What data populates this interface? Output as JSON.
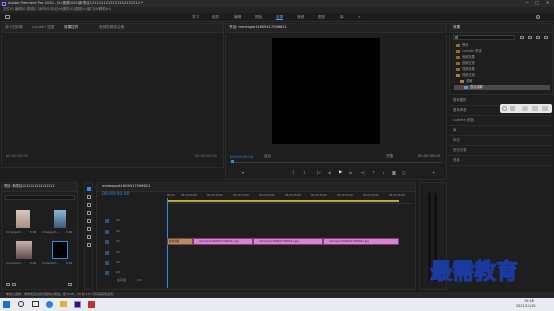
{
  "window": {
    "title": "Adobe Premiere Pro 2020 - D:\\视频\\555\\新项目1212121212121212121212 *",
    "controls": [
      "—",
      "□",
      "✕"
    ]
  },
  "menu": [
    "文件(F)",
    "编辑(E)",
    "剪辑(C)",
    "序列(S)",
    "标记(M)",
    "图形(G)",
    "视图(V)",
    "窗口(W)",
    "帮助(H)"
  ],
  "workspaces": {
    "items": [
      "学习",
      "组件",
      "编辑",
      "颜色",
      "效果",
      "音频",
      "图形",
      "库"
    ],
    "active": 4
  },
  "source_panel": {
    "tabs": [
      "源:(无剪辑)",
      "Lumetri 范围",
      "效果控件",
      "音频剪辑混合器"
    ],
    "active_tab": 2,
    "tc_left": "00:00:00:00",
    "tc_right": "00:00:00:00"
  },
  "program_panel": {
    "tab": "节目: mmexport1609417096621",
    "timecode": "00:00:00:00",
    "fit": "适合",
    "quality": "完整",
    "duration": "00:00:09:03"
  },
  "effects_panel": {
    "tab": "效果",
    "search_placeholder": "",
    "items": [
      "预设",
      "Lumetri 预设",
      "音频效果",
      "音频过渡",
      "视频效果",
      "视频过渡"
    ],
    "subitems": [
      "溶解",
      "叠加溶解"
    ]
  },
  "right_sections": [
    "基本图形",
    "基本声音",
    "Lumetri 颜色",
    "库",
    "标记",
    "历史记录",
    "信息"
  ],
  "project_panel": {
    "tabs": [
      "项目: 新项目1212121212121212",
      "媒体浏览器",
      "库",
      "信息"
    ],
    "thumbs": [
      {
        "name": "mmexport...",
        "dur": "5:00"
      },
      {
        "name": "mmexport...",
        "dur": "5:00"
      },
      {
        "name": "mmexport...",
        "dur": "5:00"
      },
      {
        "name": "mmexport...",
        "dur": "9:03"
      }
    ]
  },
  "timeline": {
    "tab": "mmexport1609417096621",
    "timecode": "00:00:00:00",
    "ruler": [
      "00:00",
      "00:00:05:00",
      "00:00:10:00",
      "00:00:15:00",
      "00:00:20:00",
      "00:00:25:00",
      "00:00:30:00",
      "00:00:35:00",
      "00:00:40:00",
      "00:00:45:00"
    ],
    "tracks": [
      "V3",
      "V2",
      "V1",
      "A1",
      "A2",
      "A3"
    ],
    "master": "主声道",
    "master_val": "0.0",
    "clips": [
      {
        "label": "叠加溶解"
      },
      {
        "label": "mmexport1609417096621.jpg"
      },
      {
        "label": "mmexport1609417096621.jpg"
      },
      {
        "label": "mmexport1609417096621.jpg"
      }
    ]
  },
  "status_bar": "单击以选择，或单击空白处并拖动以框选。用 Shift、Alt 和 Ctrl 可获得其他选项。",
  "watermark": "最需教育",
  "taskbar": {
    "time": "15:28",
    "date": "2021/11/15"
  }
}
